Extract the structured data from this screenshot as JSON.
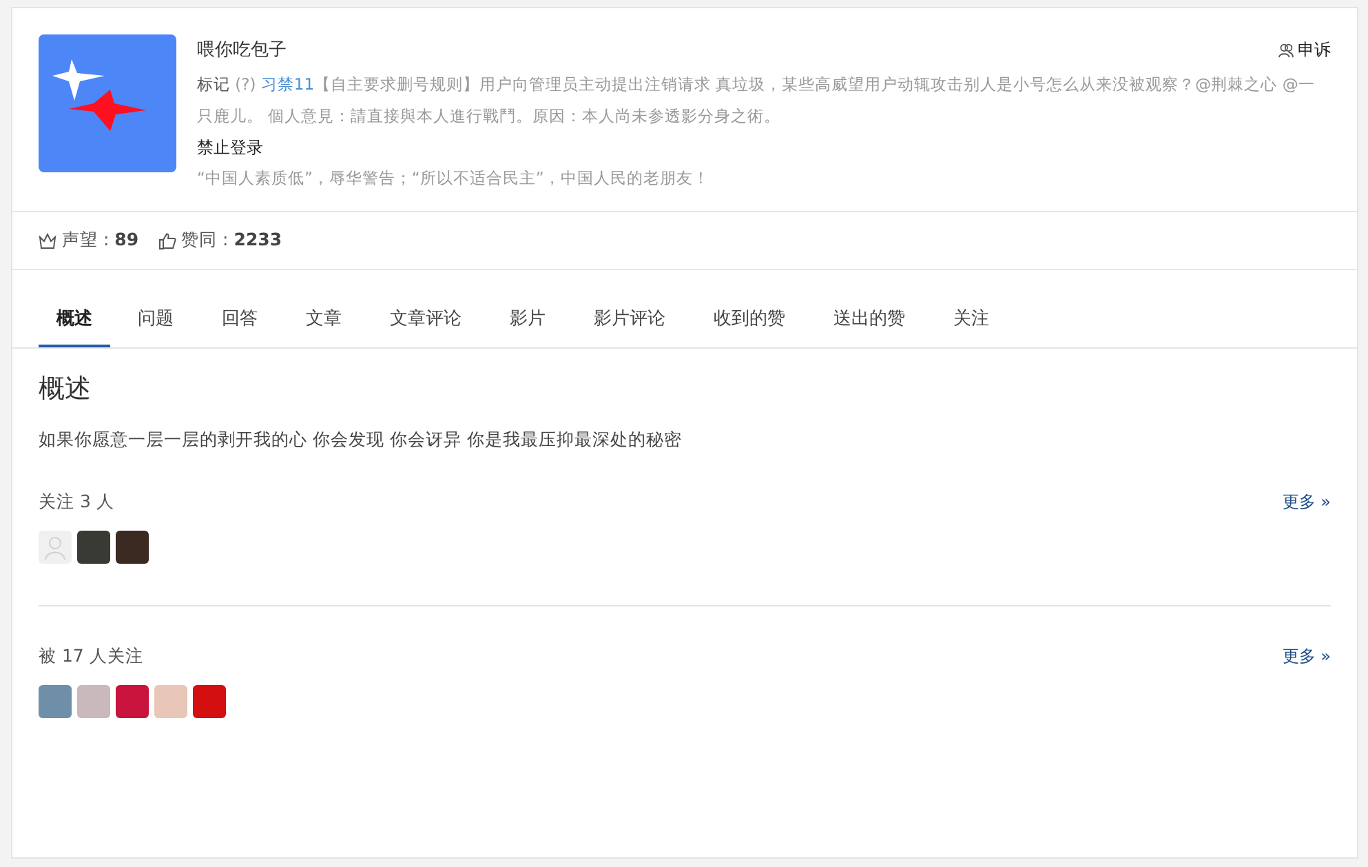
{
  "profile": {
    "name": "喂你吃包子",
    "appeal": "申诉",
    "bio": {
      "label": "标记",
      "help": "(?)",
      "tag": "习禁11",
      "text": "【自主要求删号规则】用户向管理员主动提出注销请求 真垃圾，某些高威望用户动辄攻击别人是小号怎么从来没被观察？@荆棘之心 @一只鹿儿。 個人意見：請直接與本人進行戰鬥。原因：本人尚未参透影分身之術。"
    },
    "status": "禁止登录",
    "signature": "“中国人素质低”，辱华警告；“所以不适合民主”，中国人民的老朋友！"
  },
  "stats": [
    {
      "kind": "reputation",
      "label": "声望 : ",
      "value": "89"
    },
    {
      "kind": "agree",
      "label": "赞同 : ",
      "value": "2233"
    }
  ],
  "tabs": [
    {
      "label": "概述",
      "selected": true
    },
    {
      "label": "问题",
      "selected": false
    },
    {
      "label": "回答",
      "selected": false
    },
    {
      "label": "文章",
      "selected": false
    },
    {
      "label": "文章评论",
      "selected": false
    },
    {
      "label": "影片",
      "selected": false
    },
    {
      "label": "影片评论",
      "selected": false
    },
    {
      "label": "收到的赞",
      "selected": false
    },
    {
      "label": "送出的赞",
      "selected": false
    },
    {
      "label": "关注",
      "selected": false
    }
  ],
  "overview": {
    "title": "概述",
    "intro": "如果你愿意一层一层的剥开我的心 你会发现 你会讶异 你是我最压抑最深处的秘密"
  },
  "sections": [
    {
      "title": "关注 3 人",
      "more": "更多 »",
      "avatars": [
        {
          "kind": "default"
        },
        {
          "kind": "photo",
          "color": "#3a3a34"
        },
        {
          "kind": "photo",
          "color": "#3b2a22"
        }
      ]
    },
    {
      "title": "被 17 人关注",
      "more": "更多 »",
      "avatars": [
        {
          "kind": "photo",
          "color": "#6f8fa8"
        },
        {
          "kind": "photo",
          "color": "#c9b8bc"
        },
        {
          "kind": "photo",
          "color": "#c8143c"
        },
        {
          "kind": "photo",
          "color": "#e8c6b8"
        },
        {
          "kind": "photo",
          "color": "#d40f0f"
        }
      ]
    }
  ]
}
